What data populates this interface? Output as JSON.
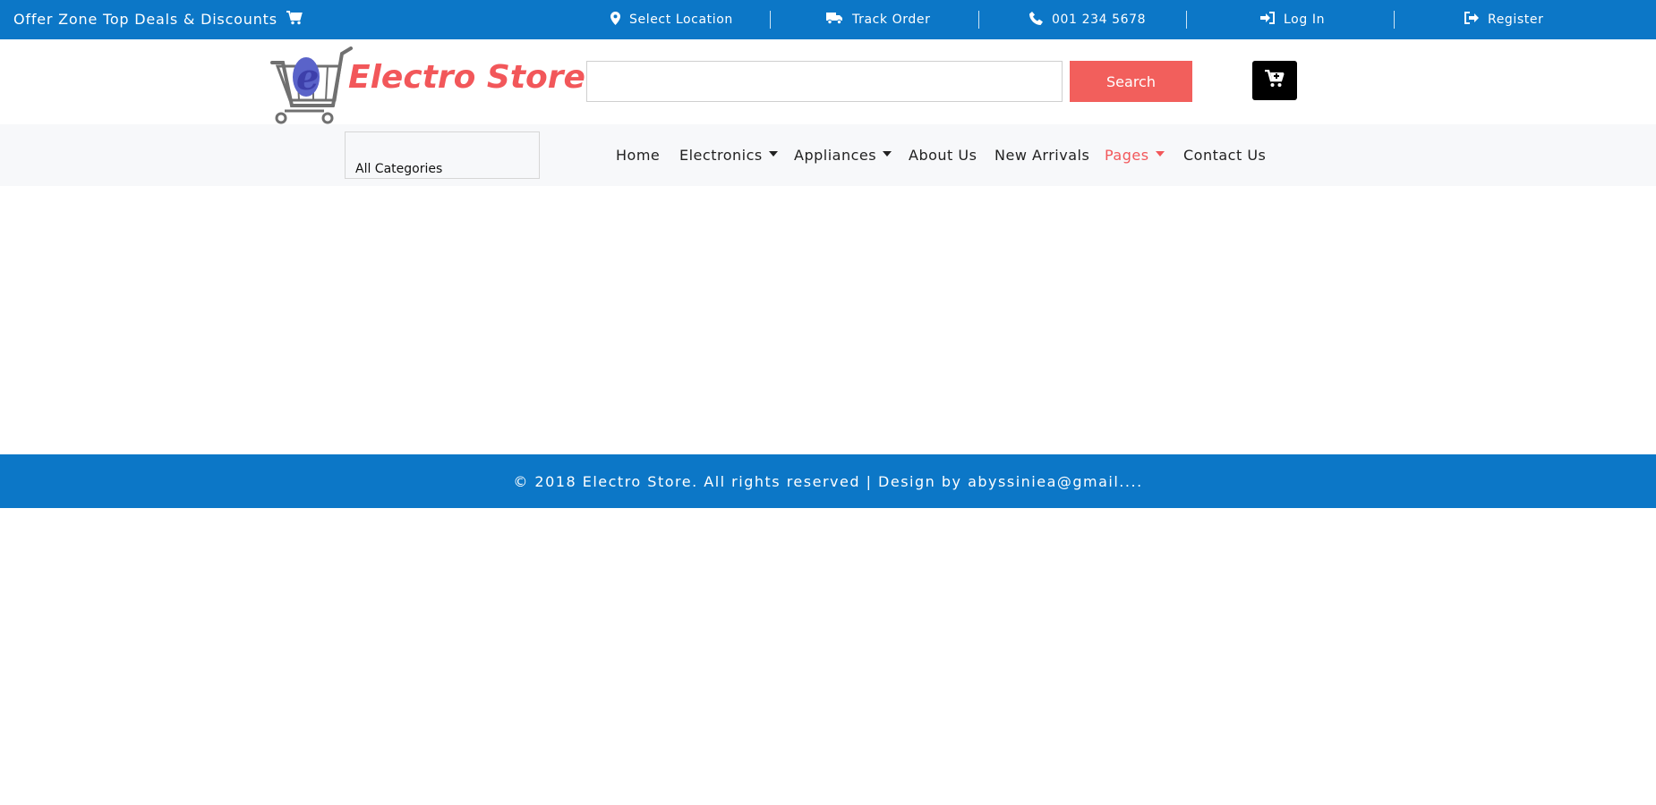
{
  "topbar": {
    "offer_text": "Offer Zone Top Deals & Discounts",
    "location": "Select Location",
    "track_order": "Track Order",
    "phone": "001 234 5678",
    "login": "Log In",
    "register": "Register"
  },
  "header": {
    "logo_text": "Electro Store",
    "search_placeholder": "",
    "search_button": "Search"
  },
  "nav": {
    "category_select": "All Categories",
    "items": [
      "Home",
      "Electronics",
      "Appliances",
      "About Us",
      "New Arrivals",
      "Pages",
      "Contact Us"
    ],
    "active": "Pages"
  },
  "footer": {
    "text": "© 2018 Electro Store. All rights reserved | Design by abyssiniea@gmail...."
  },
  "colors": {
    "primary_blue": "#0c77c7",
    "accent_red": "#f2575a",
    "cart_button": "#000000"
  }
}
